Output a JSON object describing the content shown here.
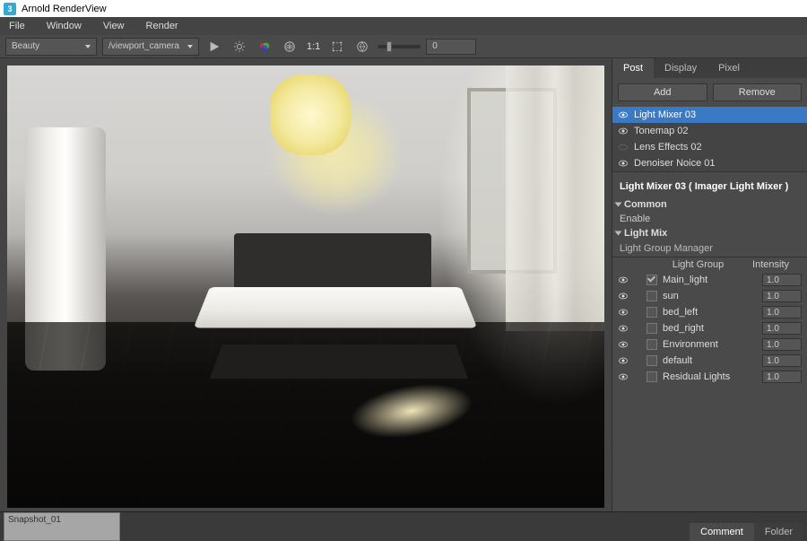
{
  "titlebar": {
    "app_icon": "3",
    "title": "Arnold RenderView"
  },
  "menubar": {
    "items": [
      "File",
      "Window",
      "View",
      "Render"
    ]
  },
  "toolbar": {
    "aov_sel": "Beauty",
    "camera_sel": "/viewport_camera",
    "ratio": "1:1",
    "numbox": "0"
  },
  "rpanel": {
    "tabs": {
      "post": "Post",
      "display": "Display",
      "pixel": "Pixel"
    },
    "buttons": {
      "add": "Add",
      "remove": "Remove"
    },
    "imagers": [
      {
        "label": "Light Mixer 03",
        "visible": true,
        "selected": true
      },
      {
        "label": "Tonemap 02",
        "visible": true,
        "selected": false
      },
      {
        "label": "Lens Effects 02",
        "visible": false,
        "selected": false
      },
      {
        "label": "Denoiser Noice 01",
        "visible": true,
        "selected": false
      }
    ],
    "section_title": "Light Mixer 03  ( Imager Light Mixer )",
    "common": {
      "header": "Common",
      "enable": "Enable"
    },
    "lightmix": {
      "header": "Light Mix",
      "lgm": "Light Group Manager",
      "col1": "Light Group",
      "col2": "Intensity",
      "rows": [
        {
          "name": "Main_light",
          "intensity": "1.0",
          "checked": true
        },
        {
          "name": "sun",
          "intensity": "1.0",
          "checked": false
        },
        {
          "name": "bed_left",
          "intensity": "1.0",
          "checked": false
        },
        {
          "name": "bed_right",
          "intensity": "1.0",
          "checked": false
        },
        {
          "name": "Environment",
          "intensity": "1.0",
          "checked": false
        },
        {
          "name": "default",
          "intensity": "1.0",
          "checked": false
        },
        {
          "name": "Residual Lights",
          "intensity": "1.0",
          "checked": false
        }
      ]
    }
  },
  "bottombar": {
    "snapshot": "Snapshot_01",
    "tabs": {
      "comment": "Comment",
      "folder": "Folder"
    }
  }
}
